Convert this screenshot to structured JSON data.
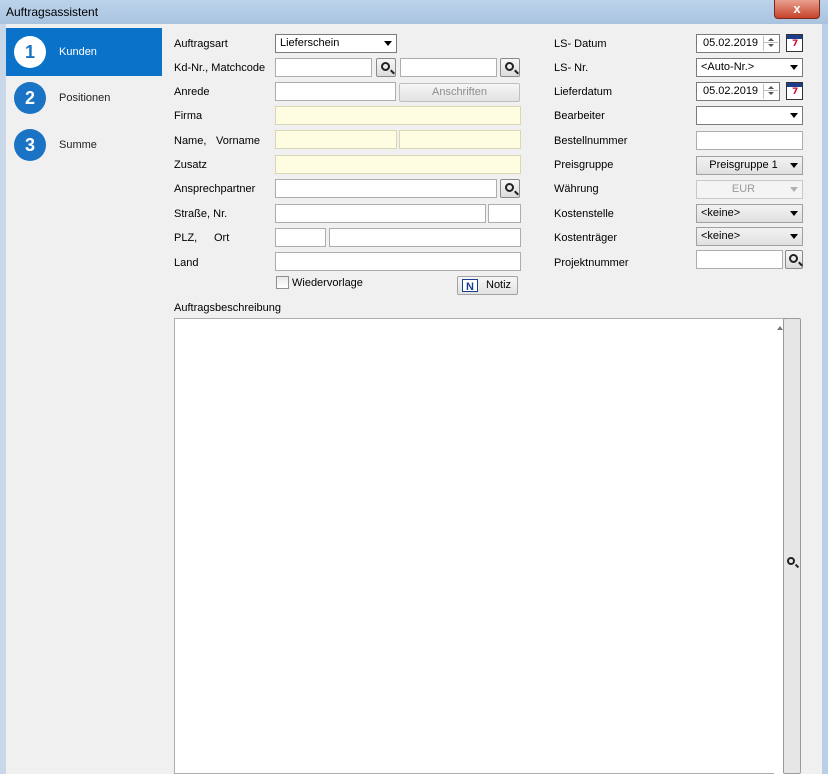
{
  "window": {
    "title": "Auftragsassistent",
    "close_label": "x"
  },
  "steps": [
    {
      "number": "1",
      "label": "Kunden",
      "active": true
    },
    {
      "number": "2",
      "label": "Positionen",
      "active": false
    },
    {
      "number": "3",
      "label": "Summe",
      "active": false
    }
  ],
  "left": {
    "auftragsart_label": "Auftragsart",
    "auftragsart_value": "Lieferschein",
    "kdnr_label": "Kd-Nr.,  Matchcode",
    "kdnr_value": "",
    "matchcode_value": "",
    "anrede_label": "Anrede",
    "anrede_value": "",
    "anschriften_button": "Anschriften",
    "firma_label": "Firma",
    "firma_value": "",
    "name_label": "Name,",
    "vorname_label": "Vorname",
    "name_value": "",
    "vorname_value": "",
    "zusatz_label": "Zusatz",
    "zusatz_value": "",
    "ansprechpartner_label": "Ansprechpartner",
    "ansprechpartner_value": "",
    "strasse_label": "Straße,  Nr.",
    "strasse_value": "",
    "nr_value": "",
    "plz_label": "PLZ,",
    "ort_label": "Ort",
    "plz_value": "",
    "ort_value": "",
    "land_label": "Land",
    "land_value": "",
    "wiedervorlage_label": "Wiedervorlage",
    "wiedervorlage_checked": false,
    "notiz_button": "Notiz"
  },
  "right": {
    "lsdatum_label": "LS- Datum",
    "lsdatum_value": "05.02.2019",
    "lsnr_label": "LS- Nr.",
    "lsnr_value": "<Auto-Nr.>",
    "lieferdatum_label": "Lieferdatum",
    "lieferdatum_value": "05.02.2019",
    "bearbeiter_label": "Bearbeiter",
    "bearbeiter_value": "",
    "bestellnummer_label": "Bestellnummer",
    "bestellnummer_value": "",
    "preisgruppe_label": "Preisgruppe",
    "preisgruppe_value": "Preisgruppe 1",
    "waehrung_label": "Währung",
    "waehrung_value": "EUR",
    "kostenstelle_label": "Kostenstelle",
    "kostenstelle_value": "<keine>",
    "kostentraeger_label": "Kostenträger",
    "kostentraeger_value": "<keine>",
    "projektnummer_label": "Projektnummer",
    "projektnummer_value": ""
  },
  "beschreibung": {
    "label": "Auftragsbeschreibung",
    "value": ""
  }
}
